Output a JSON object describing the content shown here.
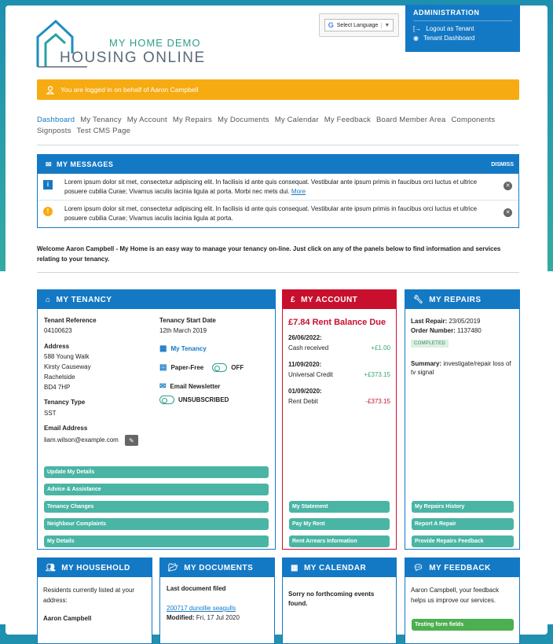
{
  "logo": {
    "sub": "MY HOME DEMO",
    "main": "HOUSING ONLINE"
  },
  "translate": {
    "label": "Select Language",
    "arrow": "▼"
  },
  "admin": {
    "title": "ADMINISTRATION",
    "links": [
      {
        "icon": "logout-icon",
        "label": "Logout as Tenant"
      },
      {
        "icon": "dashboard-icon",
        "label": "Tenant Dashboard"
      }
    ]
  },
  "alert": {
    "text": "You are logged in on behalf of Aaron Campbell"
  },
  "nav": {
    "items": [
      "Dashboard",
      "My Tenancy",
      "My Account",
      "My Repairs",
      "My Documents",
      "My Calendar",
      "My Feedback",
      "Board Member Area",
      "Components",
      "Signposts",
      "Test CMS Page"
    ]
  },
  "messages": {
    "title": "MY MESSAGES",
    "dismiss": "DISMISS",
    "items": [
      {
        "text": "Lorem ipsum dolor sit met, consectetur adipiscing elit. In facilisis id ante quis consequat. Vestibular ante ipsum primis in faucibus orci luctus et ultrice posuere cubilia Curae; Vivamus iaculis lacinia ligula at porta. Morbi nec mets dui.",
        "more": "More"
      },
      {
        "text": "Lorem ipsum dolor sit met, consectetur adipiscing elit. In facilisis id ante quis consequat. Vestibular ante ipsum primis in faucibus orci luctus et ultrice posuere cubilia Curae; Vivamus iaculis lacinia ligula at porta."
      }
    ]
  },
  "welcome": "Welcome Aaron Campbell - My Home is an easy way to manage your tenancy on-line.  Just click on any of the panels below to find information and services relating to your tenancy.",
  "tenancy": {
    "title": "MY TENANCY",
    "ref_label": "Tenant Reference",
    "ref": "04100623",
    "start_label": "Tenancy Start Date",
    "start": "12th March 2019",
    "address_label": "Address",
    "address": [
      "588 Young Walk",
      "Kirsty Causeway",
      "Rachelside",
      "BD4 7HP"
    ],
    "type_label": "Tenancy Type",
    "type": "SST",
    "email_label": "Email Address",
    "email": "liam.wilson@example.com",
    "link_tenancy": "My Tenancy",
    "paper_free": "Paper-Free",
    "paper_state": "OFF",
    "newsletter": "Email Newsletter",
    "newsletter_state": "UNSUBSCRIBED",
    "buttons": [
      "Update My Details",
      "Advice & Assistance",
      "Tenancy Changes",
      "Neighbour Complaints",
      "My Details"
    ]
  },
  "account": {
    "title": "MY ACCOUNT",
    "balance": "£7.84 Rent Balance Due",
    "entries": [
      {
        "date": "26/06/2022:",
        "desc": "Cash received",
        "amount": "+£1.00",
        "kind": "pos"
      },
      {
        "date": "11/09/2020:",
        "desc": "Universal Credit",
        "amount": "+£373.15",
        "kind": "pos"
      },
      {
        "date": "01/09/2020:",
        "desc": "Rent Debit",
        "amount": "-£373.15",
        "kind": "neg"
      }
    ],
    "buttons": [
      "My Statement",
      "Pay My Rent",
      "Rent Arrears Information"
    ]
  },
  "repairs": {
    "title": "MY REPAIRS",
    "last_label": "Last Repair:",
    "last": "23/05/2019",
    "order_label": "Order Number:",
    "order": "1137480",
    "status": "COMPLETED",
    "summary_label": "Summary:",
    "summary": "investigate/repair loss of tv signal",
    "buttons": [
      "My Repairs History",
      "Report A Repair",
      "Provide Repairs Feedback"
    ]
  },
  "household": {
    "title": "MY HOUSEHOLD",
    "intro": "Residents currently listed at your address:",
    "resident": "Aaron Campbell"
  },
  "documents": {
    "title": "MY DOCUMENTS",
    "heading": "Last document filed",
    "doc": "200717 dunollie seagulls",
    "modified_label": "Modified:",
    "modified": "Fri, 17 Jul 2020"
  },
  "calendar": {
    "title": "MY CALENDAR",
    "text": "Sorry no forthcoming events found."
  },
  "feedback": {
    "title": "MY FEEDBACK",
    "text": "Aaron Campbell, your feedback helps us improve our services.",
    "button": "Testing form fields"
  },
  "colors": {
    "primary": "#1479c4",
    "account": "#c8102e",
    "alert": "#f7ab12",
    "button": "#4ab5a4",
    "feedback_button": "#4caf50"
  }
}
